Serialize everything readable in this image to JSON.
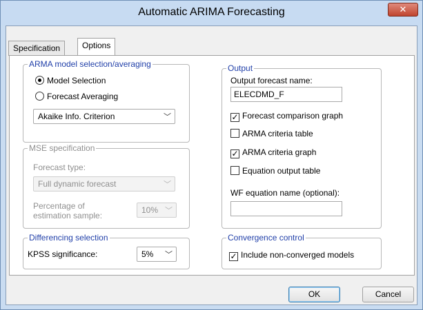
{
  "window": {
    "title": "Automatic ARIMA Forecasting",
    "close_label": "✕"
  },
  "tabs": [
    {
      "label": "Specification",
      "active": false
    },
    {
      "label": "Options",
      "active": true
    }
  ],
  "arma_group": {
    "title": "ARMA model selection/averaging",
    "radios": [
      {
        "label": "Model Selection",
        "selected": true
      },
      {
        "label": "Forecast Averaging",
        "selected": false
      }
    ],
    "criterion_value": "Akaike Info. Criterion"
  },
  "mse_group": {
    "title": "MSE specification",
    "forecast_type_label": "Forecast type:",
    "forecast_type_value": "Full dynamic forecast",
    "percentage_label_line1": "Percentage of",
    "percentage_label_line2": "estimation sample:",
    "percentage_value": "10%"
  },
  "differencing_group": {
    "title": "Differencing selection",
    "kpss_label": "KPSS significance:",
    "kpss_value": "5%"
  },
  "output_group": {
    "title": "Output",
    "forecast_name_label": "Output forecast name:",
    "forecast_name_value": "ELECDMD_F",
    "checks": [
      {
        "label": "Forecast comparison graph",
        "checked": true
      },
      {
        "label": "ARMA criteria table",
        "checked": false
      },
      {
        "label": "ARMA criteria graph",
        "checked": true
      },
      {
        "label": "Equation output table",
        "checked": false
      }
    ],
    "wf_equation_label": "WF equation name (optional):",
    "wf_equation_value": ""
  },
  "convergence_group": {
    "title": "Convergence control",
    "include_label": "Include non-converged models",
    "include_checked": true
  },
  "buttons": {
    "ok": "OK",
    "cancel": "Cancel"
  },
  "icons": {
    "chevron": "chevron-down-icon",
    "check": "check-icon"
  },
  "colors": {
    "group_title": "#1f3ea8",
    "titlebar": "#c7dbf2",
    "close_button": "#c0452f"
  }
}
